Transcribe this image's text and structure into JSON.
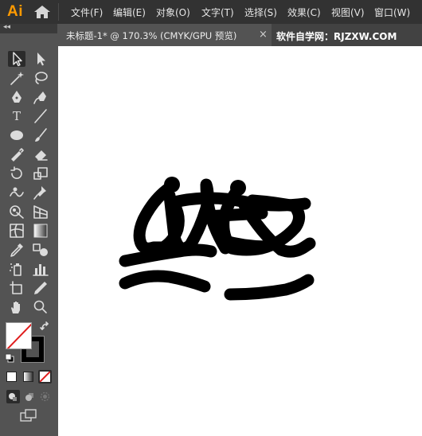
{
  "app": {
    "logo": "Ai"
  },
  "menu": [
    {
      "label": "文件(F)"
    },
    {
      "label": "编辑(E)"
    },
    {
      "label": "对象(O)"
    },
    {
      "label": "文字(T)"
    },
    {
      "label": "选择(S)"
    },
    {
      "label": "效果(C)"
    },
    {
      "label": "视图(V)"
    },
    {
      "label": "窗口(W)"
    }
  ],
  "document_tab": {
    "title": "未标题-1* @ 170.3% (CMYK/GPU 预览)",
    "close": "×"
  },
  "watermark": "软件自学网：RJZXW.COM",
  "toolbox": {
    "collapse": "◂◂",
    "type_tool_glyph": "T",
    "tools": [
      "selection-tool-icon",
      "direct-selection-tool-icon",
      "magic-wand-icon",
      "lasso-icon",
      "pen-tool-icon",
      "curvature-tool-icon",
      "type-tool-icon",
      "line-segment-icon",
      "ellipse-tool-icon",
      "paintbrush-icon",
      "shaper-tool-icon",
      "eraser-icon",
      "rotate-tool-icon",
      "scale-tool-icon",
      "warp-tool-icon",
      "puppet-warp-icon",
      "shape-builder-icon",
      "perspective-grid-icon",
      "mesh-tool-icon",
      "gradient-tool-icon",
      "eyedropper-icon",
      "blend-tool-icon",
      "symbol-sprayer-icon",
      "column-graph-icon",
      "artboard-tool-icon",
      "slice-tool-icon",
      "hand-tool-icon",
      "zoom-tool-icon"
    ],
    "fill_color": "#ffffff",
    "stroke_color": "#000000"
  },
  "colors": {
    "menubar": "#323232",
    "panel": "#535353",
    "accent": "#ff9a00",
    "canvas": "#ffffff"
  }
}
